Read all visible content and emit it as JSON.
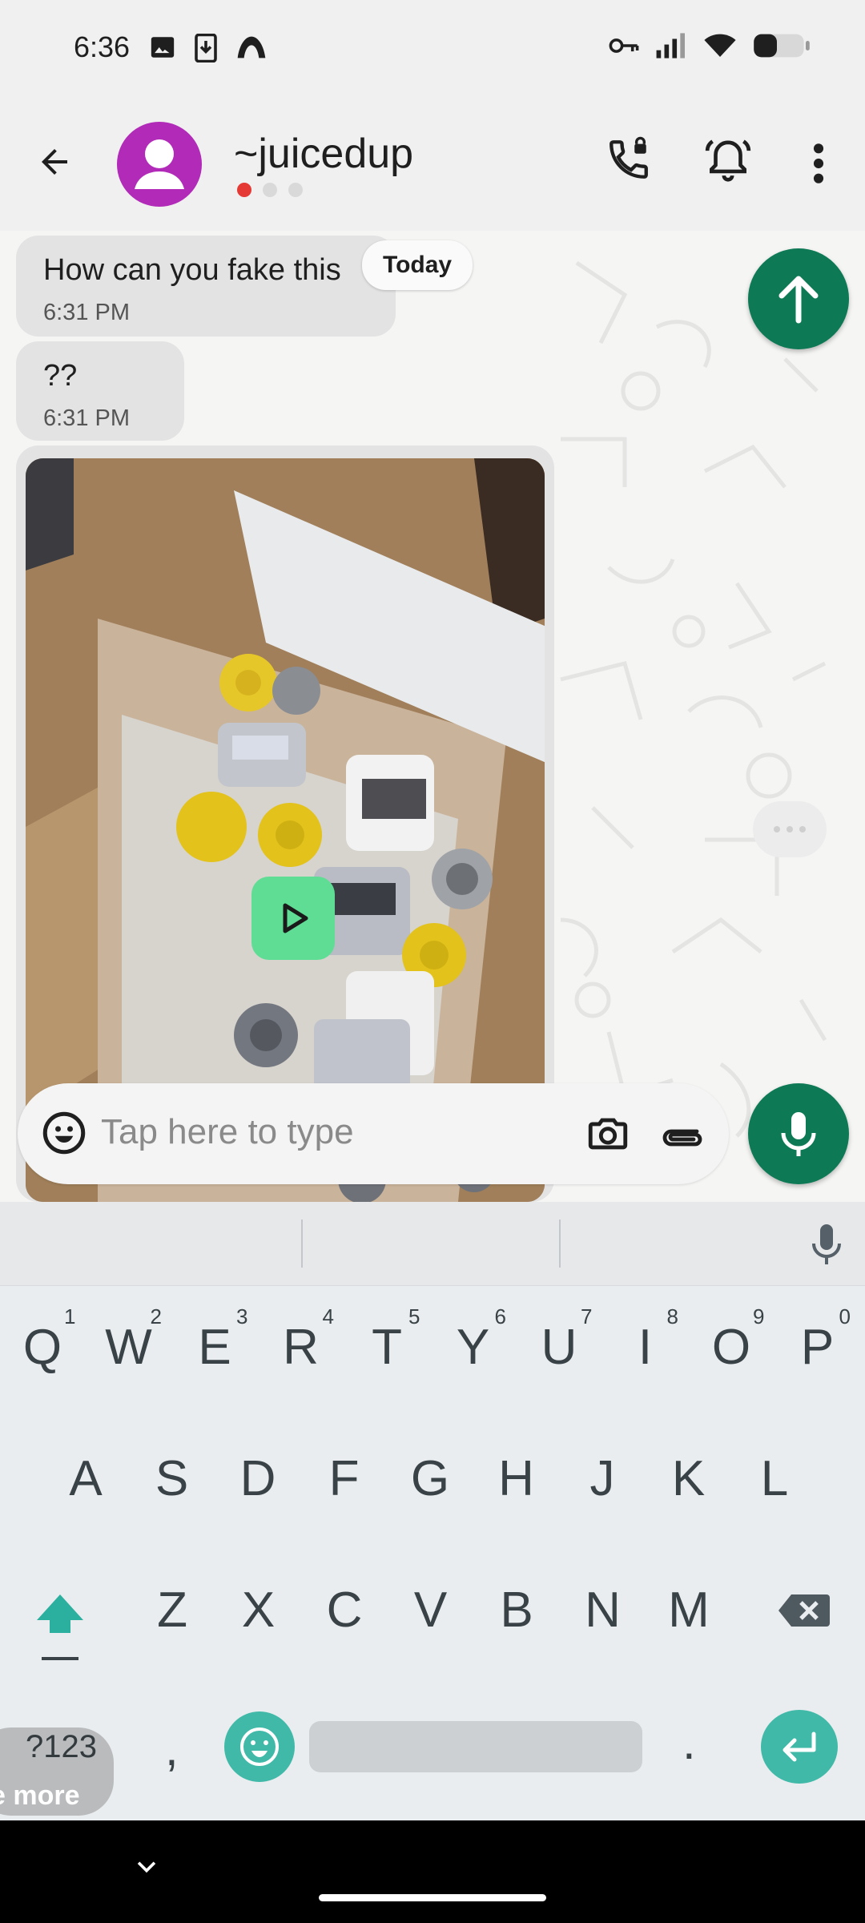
{
  "status_bar": {
    "time": "6:36"
  },
  "header": {
    "title": "~juicedup"
  },
  "messages": [
    {
      "text": "How can you fake this",
      "time": "6:31 PM"
    },
    {
      "text": "??",
      "time": "6:31 PM"
    }
  ],
  "date_chip": "Today",
  "composer": {
    "placeholder": "Tap here to type"
  },
  "keyboard": {
    "row1": [
      "Q",
      "W",
      "E",
      "R",
      "T",
      "Y",
      "U",
      "I",
      "O",
      "P"
    ],
    "row1_hints": [
      "1",
      "2",
      "3",
      "4",
      "5",
      "6",
      "7",
      "8",
      "9",
      "0"
    ],
    "row2": [
      "A",
      "S",
      "D",
      "F",
      "G",
      "H",
      "J",
      "K",
      "L"
    ],
    "row3": [
      "Z",
      "X",
      "C",
      "V",
      "B",
      "N",
      "M"
    ],
    "symbols_key": "?123",
    "comma": ",",
    "period": "."
  },
  "toast": "e more",
  "colors": {
    "accent": "#0e7a55",
    "avatar": "#b12bb8",
    "keyboard_accent": "#40b9a8",
    "play": "#5fdd94"
  }
}
